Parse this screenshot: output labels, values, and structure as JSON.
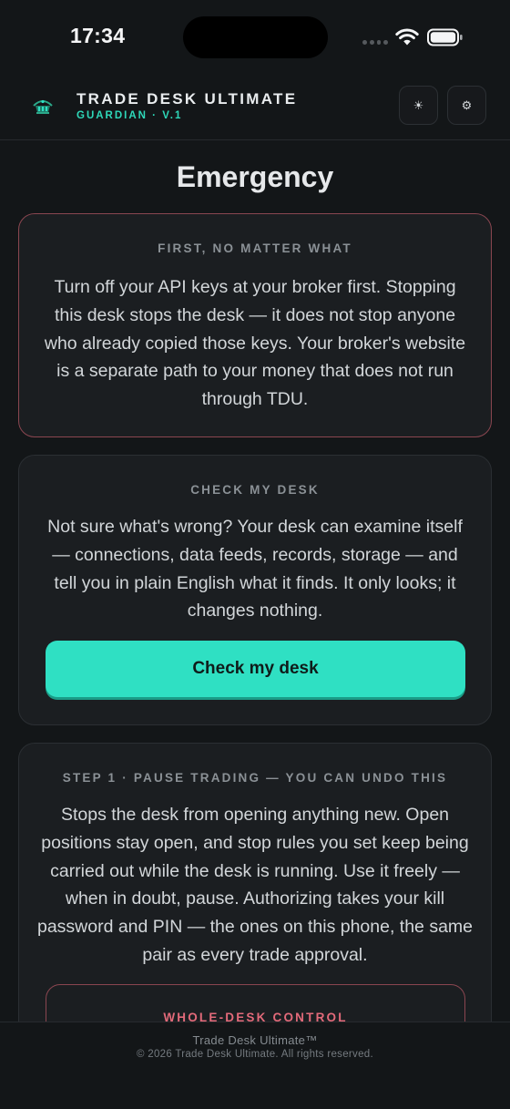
{
  "status_bar": {
    "time": "17:34"
  },
  "header": {
    "brand_title": "TRADE DESK ULTIMATE",
    "brand_subtitle": "GUARDIAN · V.1",
    "theme_icon": "☀",
    "settings_icon": "⚙"
  },
  "page": {
    "title": "Emergency"
  },
  "cards": {
    "first": {
      "label": "FIRST, NO MATTER WHAT",
      "body": "Turn off your API keys at your broker first. Stopping this desk stops the desk — it does not stop anyone who already copied those keys. Your broker's website is a separate path to your money that does not run through TDU."
    },
    "check": {
      "label": "CHECK MY DESK",
      "body": "Not sure what's wrong? Your desk can examine itself — connections, data feeds, records, storage — and tell you in plain English what it finds. It only looks; it changes nothing.",
      "button_label": "Check my desk"
    },
    "step1": {
      "label": "STEP 1 · PAUSE TRADING — YOU CAN UNDO THIS",
      "body": "Stops the desk from opening anything new. Open positions stay open, and stop rules you set keep being carried out while the desk is running. Use it freely — when in doubt, pause. Authorizing takes your kill password and PIN — the ones on this phone, the same pair as every trade approval.",
      "inner_label": "WHOLE-DESK CONTROL"
    }
  },
  "footer": {
    "name": "Trade Desk Ultimate™",
    "copyright": "© 2026 Trade Desk Ultimate. All rights reserved."
  },
  "colors": {
    "accent": "#2fe0c3",
    "danger_border": "#8a4650",
    "danger_text": "#e36a7a",
    "background": "#131618",
    "card": "#1b1e21"
  }
}
